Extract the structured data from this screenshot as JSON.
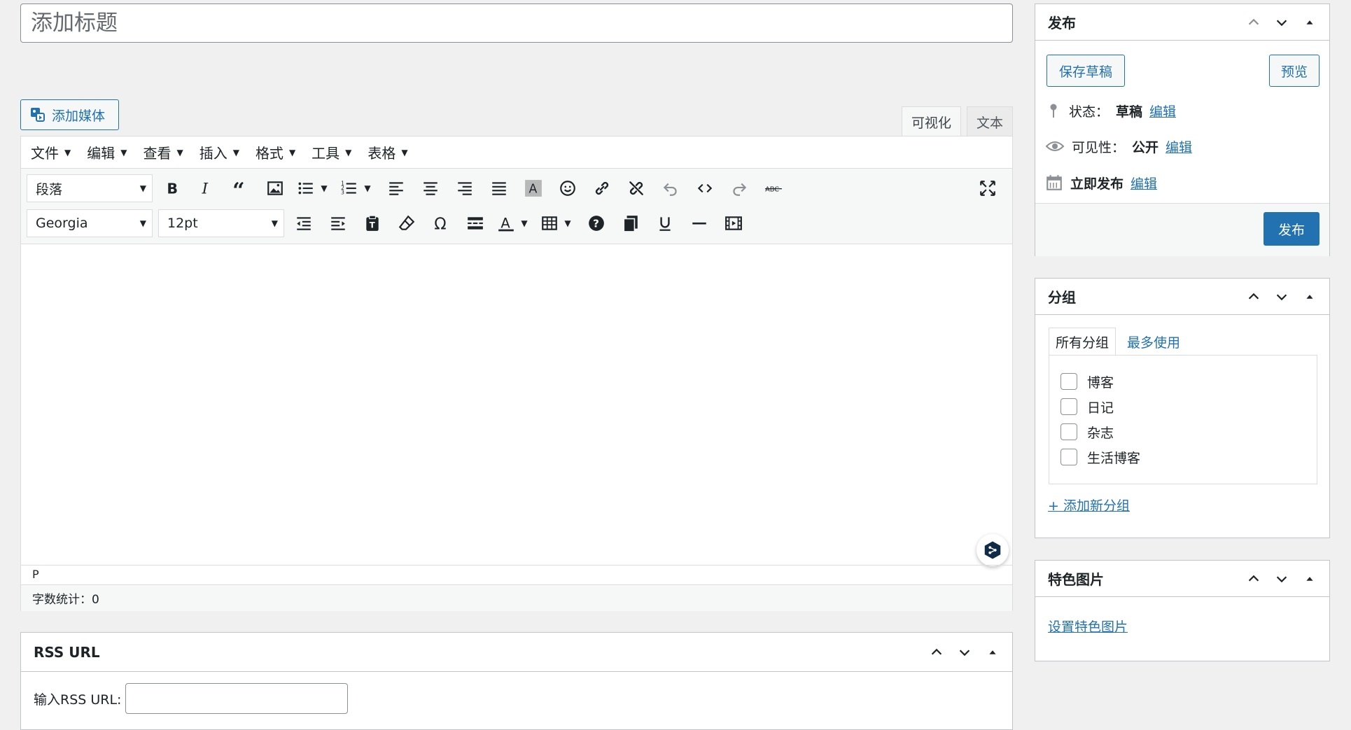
{
  "title_placeholder": "添加标题",
  "add_media": "添加媒体",
  "editor_tabs": {
    "visual": "可视化",
    "text": "文本"
  },
  "menubar": [
    "文件",
    "编辑",
    "查看",
    "插入",
    "格式",
    "工具",
    "表格"
  ],
  "toolbar": {
    "format_select": "段落",
    "font_select": "Georgia",
    "size_select": "12pt"
  },
  "path": "P",
  "word_count": "字数统计：0",
  "publish": {
    "title": "发布",
    "save_draft": "保存草稿",
    "preview": "预览",
    "status_label": "状态：",
    "status_value": "草稿",
    "visibility_label": "可见性：",
    "visibility_value": "公开",
    "schedule_label": "立即发布",
    "edit": "编辑",
    "publish_button": "发布"
  },
  "categories": {
    "title": "分组",
    "tab_all": "所有分组",
    "tab_popular": "最多使用",
    "items": [
      "博客",
      "日记",
      "杂志",
      "生活博客"
    ],
    "add_new": "+ 添加新分组"
  },
  "featured_image": {
    "title": "特色图片",
    "set_link": "设置特色图片"
  },
  "rss": {
    "title": "RSS URL",
    "label": "输入RSS URL:",
    "value": ""
  },
  "colors": {
    "accent": "#2271b1",
    "border": "#c3c4c7",
    "bg": "#f0f0f1"
  }
}
